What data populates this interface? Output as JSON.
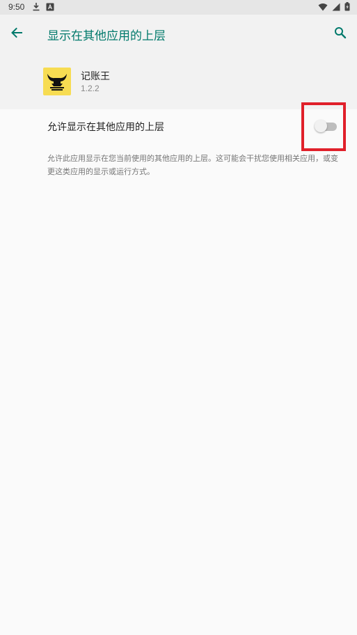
{
  "status_bar": {
    "time": "9:50",
    "icons": [
      "download-icon",
      "keyboard-a-icon",
      "wifi-icon",
      "signal-icon",
      "battery-icon"
    ]
  },
  "appbar": {
    "title": "显示在其他应用的上层",
    "back_icon": "arrow-back-icon",
    "search_icon": "search-icon"
  },
  "app": {
    "name": "记账王",
    "version": "1.2.2",
    "icon_bg": "#f7dc52"
  },
  "setting": {
    "label": "允许显示在其他应用的上层",
    "enabled": false,
    "description": "允许此应用显示在您当前使用的其他应用的上层。这可能会干扰您使用相关应用，或变更这类应用的显示或运行方式。"
  },
  "colors": {
    "accent": "#00796b",
    "highlight": "#e0202a"
  }
}
